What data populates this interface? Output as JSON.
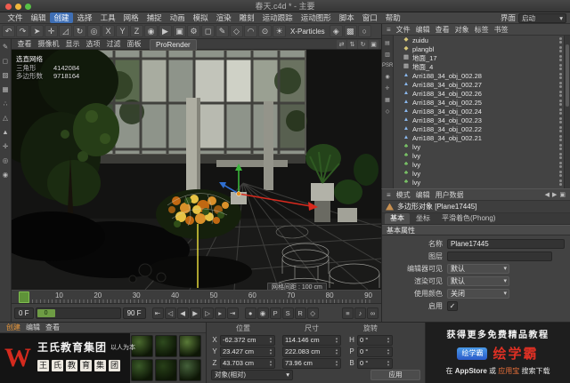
{
  "window": {
    "title": "春天.c4d * - 主要"
  },
  "icons": {
    "burger": "≡",
    "chevron_down": "▾",
    "back": "◀",
    "forward": "▶",
    "lock": "▣",
    "step_up": "▲",
    "step_down": "▼"
  },
  "menubar": {
    "items": [
      "文件",
      "编辑",
      "创建",
      "选择",
      "工具",
      "网格",
      "捕捉",
      "动画",
      "模拟",
      "渲染",
      "雕刻",
      "运动跟踪",
      "运动图形",
      "脚本",
      "窗口",
      "帮助"
    ],
    "active_item": "创建",
    "interface_label": "界面",
    "layout_value": "启动"
  },
  "toolbar": {
    "icons": [
      {
        "n": "undo-icon",
        "g": "↶"
      },
      {
        "n": "redo-icon",
        "g": "↷"
      },
      {
        "n": "live-selection-icon",
        "g": "➤"
      },
      {
        "n": "move-tool-icon",
        "g": "✛"
      },
      {
        "n": "scale-tool-icon",
        "g": "◿"
      },
      {
        "n": "rotate-tool-icon",
        "g": "↻"
      },
      {
        "n": "last-tool-icon",
        "g": "◎"
      },
      {
        "n": "lock-x-axis-icon",
        "g": "X"
      },
      {
        "n": "lock-y-axis-icon",
        "g": "Y"
      },
      {
        "n": "lock-z-axis-icon",
        "g": "Z"
      },
      {
        "n": "coordinate-system-icon",
        "g": "◉"
      },
      {
        "n": "render-view-icon",
        "g": "▶"
      },
      {
        "n": "render-picture-viewer-icon",
        "g": "▣"
      },
      {
        "n": "render-settings-icon",
        "g": "⚙"
      },
      {
        "n": "add-primitive-icon",
        "g": "◻"
      },
      {
        "n": "add-spline-icon",
        "g": "✎"
      },
      {
        "n": "add-generator-icon",
        "g": "◇"
      },
      {
        "n": "add-deformer-icon",
        "g": "◠"
      },
      {
        "n": "add-camera-icon",
        "g": "⊙"
      },
      {
        "n": "add-light-icon",
        "g": "☀"
      }
    ],
    "plugin_label": "X-Particles",
    "extra_icons": [
      {
        "n": "simulate-menu-icon",
        "g": "◈"
      },
      {
        "n": "volume-menu-icon",
        "g": "▩"
      },
      {
        "n": "mograph-menu-icon",
        "g": "○"
      }
    ]
  },
  "left_toolbar": {
    "icons": [
      {
        "n": "make-editable-icon",
        "g": "✎"
      },
      {
        "n": "model-mode-icon",
        "g": "◻"
      },
      {
        "n": "texture-mode-icon",
        "g": "▨"
      },
      {
        "n": "workplane-icon",
        "g": "▦"
      },
      {
        "n": "points-mode-icon",
        "g": "∴"
      },
      {
        "n": "edges-mode-icon",
        "g": "△"
      },
      {
        "n": "polygons-mode-icon",
        "g": "▲"
      },
      {
        "n": "axis-mode-icon",
        "g": "✛"
      },
      {
        "n": "viewport-filter-icon",
        "g": "◎"
      },
      {
        "n": "snap-toggle-icon",
        "g": "◉"
      }
    ]
  },
  "viewport": {
    "menus": [
      "查看",
      "摄像机",
      "显示",
      "选项",
      "过滤",
      "面板"
    ],
    "prorender_tab": "ProRender",
    "nav_icons": [
      {
        "n": "pan-view-icon",
        "g": "⇄"
      },
      {
        "n": "zoom-view-icon",
        "g": "⇅"
      },
      {
        "n": "rotate-view-icon",
        "g": "↻"
      },
      {
        "n": "toggle-layout-icon",
        "g": "▣"
      }
    ],
    "hud": {
      "title": "选直网络",
      "rows": [
        {
          "label": "三角形",
          "value": "4142084"
        },
        {
          "label": "多边形数",
          "value": "9718164"
        }
      ]
    },
    "grid_label": "网格间距 : 100 cm"
  },
  "timeline": {
    "frames": [
      "0",
      "10",
      "20",
      "30",
      "40",
      "50",
      "60",
      "70",
      "80",
      "90"
    ],
    "current_frame": "0 F",
    "end_frame": "90 F",
    "knob_label": "0",
    "transport_icons": [
      {
        "n": "goto-start-icon",
        "g": "⇤"
      },
      {
        "n": "previous-key-icon",
        "g": "◁"
      },
      {
        "n": "previous-frame-icon",
        "g": "◀"
      },
      {
        "n": "play-icon",
        "g": "▶"
      },
      {
        "n": "next-frame-icon",
        "g": "▷"
      },
      {
        "n": "next-key-icon",
        "g": "▸"
      },
      {
        "n": "goto-end-icon",
        "g": "⇥"
      }
    ],
    "key_icons": [
      {
        "n": "record-keyframe-icon",
        "g": "●"
      },
      {
        "n": "autokey-icon",
        "g": "◉"
      },
      {
        "n": "key-position-icon",
        "g": "P"
      },
      {
        "n": "key-scale-icon",
        "g": "S"
      },
      {
        "n": "key-rotation-icon",
        "g": "R"
      },
      {
        "n": "key-parameter-icon",
        "g": "◇"
      }
    ],
    "right_icons": [
      {
        "n": "playback-rate-icon",
        "g": "≡"
      },
      {
        "n": "sound-toggle-icon",
        "g": "♪"
      },
      {
        "n": "loop-mode-icon",
        "g": "∞"
      }
    ]
  },
  "object_manager": {
    "menu": [
      "文件",
      "编辑",
      "查看",
      "对象",
      "标签",
      "书签"
    ],
    "strip_icons": [
      {
        "n": "om-filter-icon",
        "g": "▤"
      },
      {
        "n": "om-layers-icon",
        "g": "▥"
      },
      {
        "n": "psr-toggle",
        "g": "PSR"
      },
      {
        "n": "om-snap-icon",
        "g": "◉"
      },
      {
        "n": "om-axis-icon",
        "g": "✛"
      },
      {
        "n": "om-grid-icon",
        "g": "▦"
      },
      {
        "n": "om-misc-icon",
        "g": "◇"
      }
    ],
    "items": [
      {
        "name": "zuidu",
        "kind": "null",
        "g": "◆"
      },
      {
        "name": "plangbl",
        "kind": "null",
        "g": "◆"
      },
      {
        "name": "地面_17",
        "kind": "plane",
        "g": "▦"
      },
      {
        "name": "地面_4",
        "kind": "plane",
        "g": "▦"
      },
      {
        "name": "Arri188_34_obj_002.28",
        "kind": "mesh",
        "g": "▲"
      },
      {
        "name": "Arri188_34_obj_002.27",
        "kind": "mesh",
        "g": "▲"
      },
      {
        "name": "Arri188_34_obj_002.26",
        "kind": "mesh",
        "g": "▲"
      },
      {
        "name": "Arri188_34_obj_002.25",
        "kind": "mesh",
        "g": "▲"
      },
      {
        "name": "Arri188_34_obj_002.24",
        "kind": "mesh",
        "g": "▲"
      },
      {
        "name": "Arri188_34_obj_002.23",
        "kind": "mesh",
        "g": "▲"
      },
      {
        "name": "Arri188_34_obj_002.22",
        "kind": "mesh",
        "g": "▲"
      },
      {
        "name": "Arri188_34_obj_002.21",
        "kind": "mesh",
        "g": "▲"
      },
      {
        "name": "lvy",
        "kind": "ivy",
        "g": "♣"
      },
      {
        "name": "lvy",
        "kind": "ivy",
        "g": "♣"
      },
      {
        "name": "lvy",
        "kind": "ivy",
        "g": "♣"
      },
      {
        "name": "lvy",
        "kind": "ivy",
        "g": "♣"
      },
      {
        "name": "lvy",
        "kind": "ivy",
        "g": "♣"
      }
    ]
  },
  "attribute_manager": {
    "menu": [
      "模式",
      "编辑",
      "用户数据"
    ],
    "title": "多边形对象 [Plane17445]",
    "tabs": [
      "基本",
      "坐标",
      "平滑着色(Phong)"
    ],
    "active_tab": "基本",
    "section": "基本属性",
    "rows": [
      {
        "label": "名称",
        "value": "Plane17445",
        "kind": "text"
      },
      {
        "label": "图层",
        "value": "",
        "kind": "box"
      },
      {
        "label": "编辑器可见",
        "value": "默认",
        "kind": "dropdown"
      },
      {
        "label": "渲染可见",
        "value": "默认",
        "kind": "dropdown"
      },
      {
        "label": "使用颜色",
        "value": "关闭",
        "kind": "dropdown"
      },
      {
        "label": "启用",
        "value": "✓",
        "kind": "check"
      }
    ]
  },
  "materials": {
    "menu": [
      "创建",
      "编辑",
      "查看"
    ],
    "active_item": "创建",
    "thumbnails": [
      {
        "color": "#4a6a2e"
      },
      {
        "color": "#2e4a1e"
      },
      {
        "color": "#5a7a38"
      },
      {
        "color": "#3a5a28"
      },
      {
        "color": "#273f18"
      },
      {
        "color": "#44603a"
      }
    ]
  },
  "coordinates": {
    "position": {
      "header": "位置",
      "rows": [
        {
          "axis": "X",
          "value": "-62.372 cm"
        },
        {
          "axis": "Y",
          "value": "23.427 cm"
        },
        {
          "axis": "Z",
          "value": "43.703 cm"
        }
      ]
    },
    "size": {
      "header": "尺寸",
      "rows": [
        {
          "value": "114.146 cm"
        },
        {
          "value": "222.083 cm"
        },
        {
          "value": "73.96 cm"
        }
      ]
    },
    "rotation": {
      "header": "旋转",
      "rows": [
        {
          "axis": "H",
          "value": "0 °"
        },
        {
          "axis": "P",
          "value": "0 °"
        },
        {
          "axis": "B",
          "value": "0 °"
        }
      ]
    },
    "mode_value": "对象(相对)",
    "apply_label": "应用"
  },
  "ad_left": {
    "logo_letter": "W",
    "org_name": "王氏教育集团",
    "slogan": "以人为本",
    "seals": [
      "王",
      "氏",
      "教",
      "育",
      "集",
      "团"
    ]
  },
  "ad_right": {
    "line1": "获得更多免费精品教程",
    "badge_text": "绘学霸",
    "app_name": "绘学霸",
    "line3_prefix": "在 ",
    "store1": "AppStore",
    "mid": " 或 ",
    "store2": "应用宝",
    "suffix": " 搜索下载"
  },
  "colors": {
    "menu_highlight_blue": "#3f6fb5",
    "brand_red": "#d42a1e",
    "accent_orange": "#e8973a",
    "axis_red": "#d82a1e",
    "axis_green": "#3bb53b",
    "axis_blue": "#2f6fd0",
    "scrubber_green": "#5f9339"
  }
}
